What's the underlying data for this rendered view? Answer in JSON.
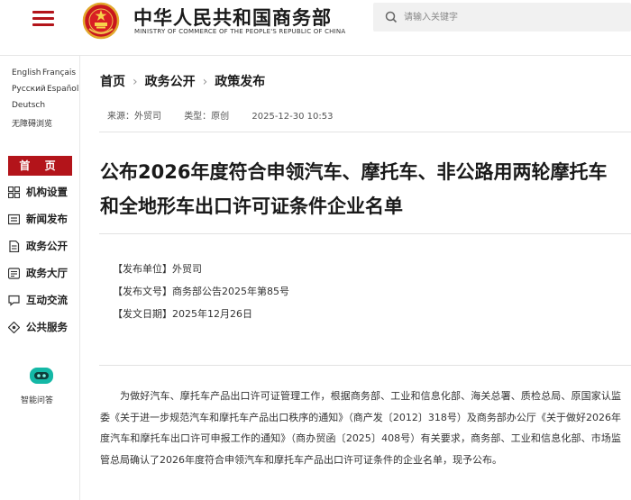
{
  "header": {
    "brand_cn": "中华人民共和国商务部",
    "brand_en": "MINISTRY OF COMMERCE OF THE PEOPLE'S REPUBLIC OF CHINA",
    "search_placeholder": "请输入关键字",
    "accent_color": "#b3141a"
  },
  "sidebar": {
    "languages": [
      "English",
      "Français",
      "Русский",
      "Español",
      "Deutsch",
      "无障碍浏览"
    ],
    "home_label": "首 页",
    "nav": [
      {
        "label": "机构设置",
        "icon": "grid-icon"
      },
      {
        "label": "新闻发布",
        "icon": "news-icon"
      },
      {
        "label": "政务公开",
        "icon": "document-icon"
      },
      {
        "label": "政务大厅",
        "icon": "list-icon"
      },
      {
        "label": "互动交流",
        "icon": "chat-icon"
      },
      {
        "label": "公共服务",
        "icon": "service-icon"
      }
    ],
    "assistant_label": "智能问答"
  },
  "breadcrumb": [
    "首页",
    "政务公开",
    "政策发布"
  ],
  "meta": {
    "source": "来源：外贸司",
    "type": "类型：原创",
    "datetime": "2025-12-30 10:53"
  },
  "article": {
    "title": "公布2026年度符合申领汽车、摩托车、非公路用两轮摩托车和全地形车出口许可证条件企业名单",
    "issuer": "【发布单位】外贸司",
    "doc_no": "【发布文号】商务部公告2025年第85号",
    "date": "【发文日期】2025年12月26日",
    "body": "为做好汽车、摩托车产品出口许可证管理工作，根据商务部、工业和信息化部、海关总署、质检总局、原国家认监委《关于进一步规范汽车和摩托车产品出口秩序的通知》（商产发〔2012〕318号）及商务部办公厅《关于做好2026年度汽车和摩托车出口许可申报工作的通知》（商办贸函〔2025〕408号）有关要求，商务部、工业和信息化部、市场监管总局确认了2026年度符合申领汽车和摩托车产品出口许可证条件的企业名单，现予公布。"
  }
}
